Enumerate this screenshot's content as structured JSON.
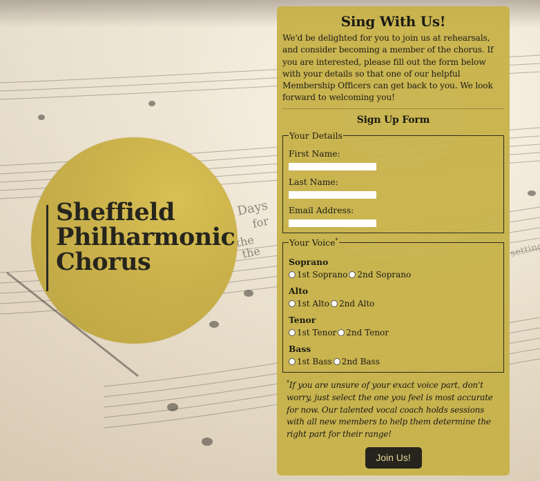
{
  "logo": {
    "lines": [
      "Sheffield",
      "Philharmonic",
      "Chorus"
    ]
  },
  "panel": {
    "title": "Sing With Us!",
    "intro": "We'd be delighted for you to join us at rehearsals, and consider becoming a member of the chorus. If you are interested, please fill out the form below with your details so that one of our helpful Membership Officers can get back to you. We look forward to welcoming you!",
    "form_title": "Sign Up Form",
    "details": {
      "legend": "Your Details",
      "first_name_label": "First Name:",
      "last_name_label": "Last Name:",
      "email_label": "Email Address:",
      "first_name_value": "",
      "last_name_value": "",
      "email_value": ""
    },
    "voice": {
      "legend": "Your Voice",
      "legend_mark": "*",
      "groups": [
        {
          "name": "Soprano",
          "options": [
            "1st Soprano",
            "2nd Soprano"
          ]
        },
        {
          "name": "Alto",
          "options": [
            "1st Alto",
            "2nd Alto"
          ]
        },
        {
          "name": "Tenor",
          "options": [
            "1st Tenor",
            "2nd Tenor"
          ]
        },
        {
          "name": "Bass",
          "options": [
            "1st Bass",
            "2nd Bass"
          ]
        }
      ]
    },
    "note_mark": "*",
    "note": "If you are unsure of your exact voice part, don't worry, just select the one you feel is most accurate for now. Our talented vocal coach holds sessions with all new members to help them determine the right part for their range!",
    "submit_label": "Join Us!"
  },
  "background": {
    "visible_words": [
      "Days",
      "for",
      "the",
      "the",
      "setting"
    ]
  },
  "colors": {
    "panel": "#c6b046",
    "logo_circle": "#c9b04a",
    "button": "#26241c",
    "button_text": "#e8d89a"
  }
}
